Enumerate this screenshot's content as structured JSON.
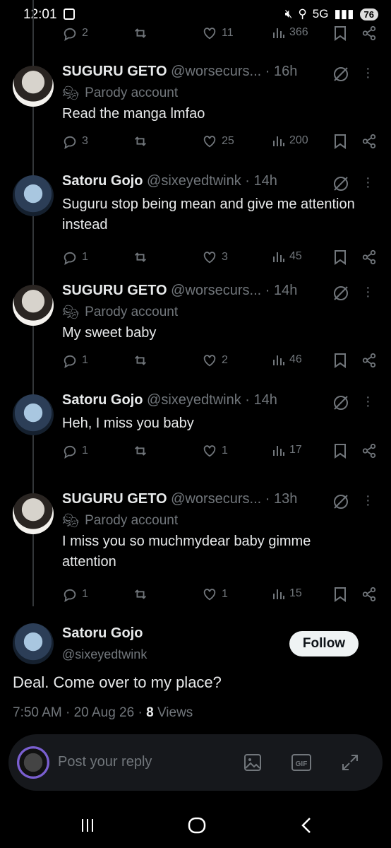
{
  "status": {
    "time": "12:01",
    "network": "5G",
    "battery": "76"
  },
  "top_actions": {
    "replies": "2",
    "likes": "11",
    "views": "366"
  },
  "posts": [
    {
      "name": "SUGURU GETO",
      "handle": "@worsecurs...",
      "time": "· 16h",
      "parody": "Parody account",
      "text": "Read the manga lmfao",
      "replies": "3",
      "likes": "25",
      "views": "200"
    },
    {
      "name": "Satoru Gojo",
      "handle": "@sixeyedtwink",
      "time": "· 14h",
      "parody": "",
      "text": "Suguru stop being mean and give me attention instead",
      "replies": "1",
      "likes": "3",
      "views": "45"
    },
    {
      "name": "SUGURU GETO",
      "handle": "@worsecurs...",
      "time": "· 14h",
      "parody": "Parody account",
      "text": "My sweet baby",
      "replies": "1",
      "likes": "2",
      "views": "46"
    },
    {
      "name": "Satoru Gojo",
      "handle": "@sixeyedtwink",
      "time": "· 14h",
      "parody": "",
      "text": "Heh, I miss you baby",
      "replies": "1",
      "likes": "1",
      "views": "17"
    },
    {
      "name": "SUGURU GETO",
      "handle": "@worsecurs...",
      "time": "· 13h",
      "parody": "Parody account",
      "text": "I miss you so muchmydear baby gimme attention",
      "replies": "1",
      "likes": "1",
      "views": "15"
    }
  ],
  "main": {
    "name": "Satoru Gojo",
    "handle": "@sixeyedtwink",
    "follow": "Follow",
    "text": "Deal. Come over to my place?",
    "time": "7:50 AM",
    "date": "20 Aug 26",
    "views_count": "8",
    "views_label": "Views"
  },
  "reply": {
    "placeholder": "Post your reply"
  },
  "icons": [
    "reply-icon",
    "repost-icon",
    "like-icon",
    "views-icon",
    "bookmark-icon",
    "share-icon",
    "grok-icon",
    "more-icon",
    "image-icon",
    "gif-icon",
    "expand-icon",
    "recents-icon",
    "home-icon",
    "back-icon"
  ],
  "colors": {
    "background": "#000000",
    "text": "#e7e9ea",
    "muted": "#71767b",
    "button": "#eff3f4"
  }
}
